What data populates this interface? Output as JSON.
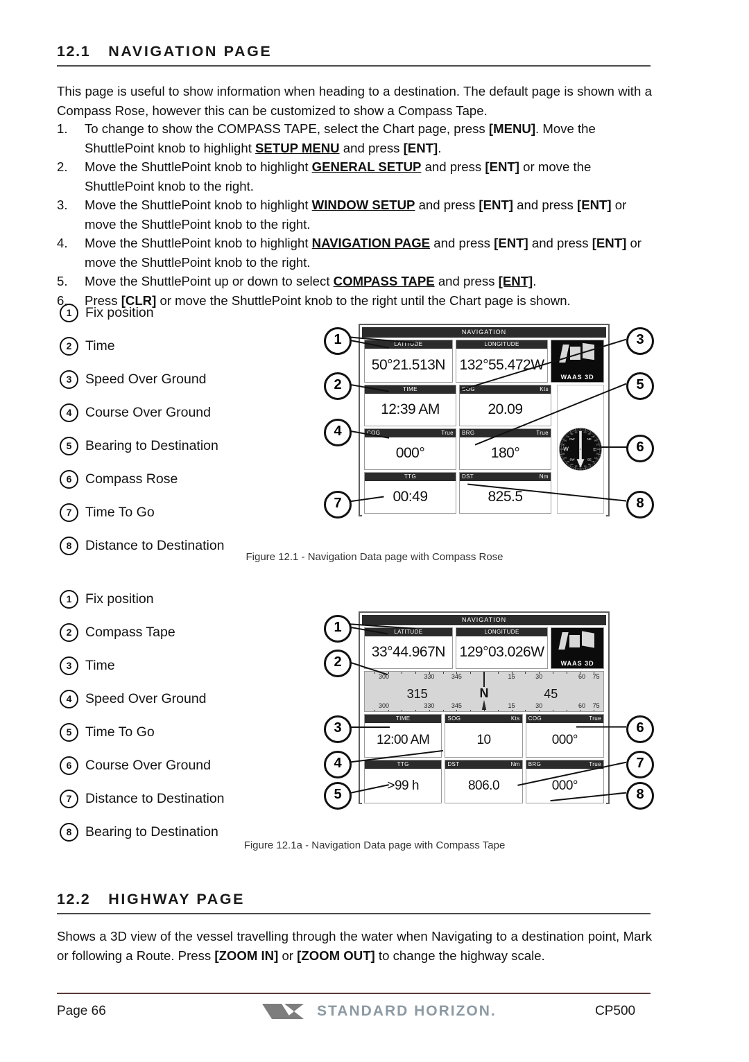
{
  "sections": {
    "nav": {
      "number": "12.1",
      "title": "NAVIGATION PAGE",
      "intro": "This page is useful to show information when heading to a destination. The default page is shown with a Compass Rose, however this can be customized to show a Compass Tape.",
      "steps": [
        {
          "n": "1.",
          "text": "To change to show the COMPASS TAPE, select the Chart page, press [MENU]. Move the ShuttlePoint knob to highlight SETUP MENU and press [ENT]."
        },
        {
          "n": "2.",
          "text": "Move the ShuttlePoint knob to highlight GENERAL SETUP and press [ENT] or move the ShuttlePoint knob to the right."
        },
        {
          "n": "3.",
          "text": "Move the ShuttlePoint knob to highlight WINDOW SETUP and press [ENT] and press [ENT] or move the ShuttlePoint knob to the right."
        },
        {
          "n": "4.",
          "text": "Move the ShuttlePoint knob to highlight NAVIGATION PAGE and press [ENT] and press [ENT] or move the ShuttlePoint knob to the right."
        },
        {
          "n": "5.",
          "text": "Move the ShuttlePoint up or down to select COMPASS TAPE and press [ENT]."
        },
        {
          "n": "6.",
          "text": "Press [CLR] or move the ShuttlePoint knob to the right until the Chart page is shown."
        }
      ]
    },
    "highway": {
      "number": "12.2",
      "title": "HIGHWAY PAGE",
      "body": "Shows a 3D view of the vessel travelling through the water when Navigating to a destination point, Mark or following a Route. Press [ZOOM IN] or [ZOOM OUT] to change the highway scale."
    }
  },
  "figure1": {
    "caption": "Figure 12.1 - Navigation Data page with Compass Rose",
    "legend": [
      {
        "n": "1",
        "label": "Fix position"
      },
      {
        "n": "2",
        "label": "Time"
      },
      {
        "n": "3",
        "label": "Speed Over Ground"
      },
      {
        "n": "4",
        "label": "Course Over Ground"
      },
      {
        "n": "5",
        "label": "Bearing to Destination"
      },
      {
        "n": "6",
        "label": "Compass Rose"
      },
      {
        "n": "7",
        "label": "Time To Go"
      },
      {
        "n": "8",
        "label": "Distance to Destination"
      }
    ],
    "screen": {
      "title": "NAVIGATION",
      "latitude": {
        "label": "LATITUDE",
        "value": "50°21.513N"
      },
      "longitude": {
        "label": "LONGITUDE",
        "value": "132°55.472W"
      },
      "waas": {
        "label": "WAAS  3D"
      },
      "fields": [
        {
          "label": "TIME",
          "unit": "",
          "value": "12:39 AM"
        },
        {
          "label": "SOG",
          "unit": "Kts",
          "value": "20.09"
        },
        {
          "label": "COG",
          "unit": "True",
          "value": "000°"
        },
        {
          "label": "BRG",
          "unit": "True",
          "value": "180°"
        },
        {
          "label": "TTG",
          "unit": "",
          "value": "00:49"
        },
        {
          "label": "DST",
          "unit": "Nm",
          "value": "825.5"
        }
      ],
      "compass_rose": {
        "cardinals": [
          "W",
          "E",
          "NW",
          "NE",
          "SW",
          "SE"
        ],
        "ring_labels": [
          "000",
          "015",
          "030",
          "045",
          "060",
          "075",
          "090",
          "105",
          "120",
          "135",
          "150",
          "165",
          "180",
          "195",
          "210",
          "225",
          "240",
          "255",
          "270",
          "285",
          "300",
          "315",
          "330",
          "345"
        ],
        "needle_heading_deg": 180
      }
    },
    "callouts": [
      "1",
      "2",
      "3",
      "4",
      "5",
      "6",
      "7",
      "8"
    ]
  },
  "figure2": {
    "caption": "Figure 12.1a - Navigation Data page with Compass Tape",
    "legend": [
      {
        "n": "1",
        "label": "Fix position"
      },
      {
        "n": "2",
        "label": "Compass Tape"
      },
      {
        "n": "3",
        "label": "Time"
      },
      {
        "n": "4",
        "label": "Speed Over Ground"
      },
      {
        "n": "5",
        "label": "Time To Go"
      },
      {
        "n": "6",
        "label": "Course Over Ground"
      },
      {
        "n": "7",
        "label": "Distance to Destination"
      },
      {
        "n": "8",
        "label": "Bearing to Destination"
      }
    ],
    "screen": {
      "title": "NAVIGATION",
      "latitude": {
        "label": "LATITUDE",
        "value": "33°44.967N"
      },
      "longitude": {
        "label": "LONGITUDE",
        "value": "129°03.026W"
      },
      "waas": {
        "label": "WAAS  3D"
      },
      "tape": {
        "ticks": [
          "300",
          "330",
          "345",
          "15",
          "30",
          "60",
          "75"
        ],
        "big_left": "315",
        "big_center": "N",
        "big_right": "45"
      },
      "fields": [
        {
          "label": "TIME",
          "unit": "",
          "value": "12:00 AM"
        },
        {
          "label": "SOG",
          "unit": "Kts",
          "value": "10"
        },
        {
          "label": "COG",
          "unit": "True",
          "value": "000°"
        },
        {
          "label": "TTG",
          "unit": "",
          "value": ">99 h"
        },
        {
          "label": "DST",
          "unit": "Nm",
          "value": "806.0"
        },
        {
          "label": "BRG",
          "unit": "True",
          "value": "000°"
        }
      ]
    },
    "callouts": [
      "1",
      "2",
      "3",
      "4",
      "5",
      "6",
      "7",
      "8"
    ]
  },
  "footer": {
    "page": "Page  66",
    "brand": "STANDARD HORIZON.",
    "model": "CP500"
  },
  "colors": {
    "rule": "#4a4a4a",
    "footer_rule": "#5a3a3a",
    "brand_text": "#8d9aa3",
    "screen_dark": "#2b2b2b",
    "tape_bg": "#d6d6d6"
  }
}
